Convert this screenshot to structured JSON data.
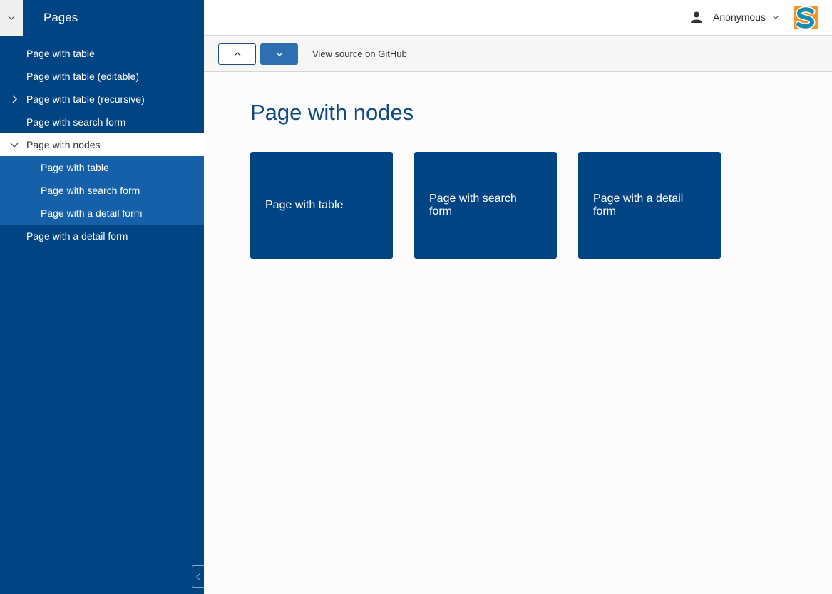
{
  "sidebar": {
    "title": "Pages",
    "items": [
      {
        "label": "Page with table"
      },
      {
        "label": "Page with table (editable)"
      },
      {
        "label": "Page with table (recursive)"
      },
      {
        "label": "Page with search form"
      },
      {
        "label": "Page with nodes"
      },
      {
        "label": "Page with table"
      },
      {
        "label": "Page with search form"
      },
      {
        "label": "Page with a detail form"
      },
      {
        "label": "Page with a detail form"
      }
    ]
  },
  "topbar": {
    "user_name": "Anonymous",
    "logo_letter": "S",
    "logo_colors": {
      "bg": "#f7941d",
      "letter": "#1a8bb0"
    }
  },
  "toolbar": {
    "github_link": "View source on GitHub"
  },
  "main": {
    "title": "Page with nodes",
    "cards": [
      {
        "label": "Page with table"
      },
      {
        "label": "Page with search form"
      },
      {
        "label": "Page with a detail form"
      }
    ]
  },
  "colors": {
    "sidebar_bg": "#004483",
    "sidebar_child_bg": "#1560a8",
    "title": "#0e4a84",
    "card_bg": "#004483"
  }
}
